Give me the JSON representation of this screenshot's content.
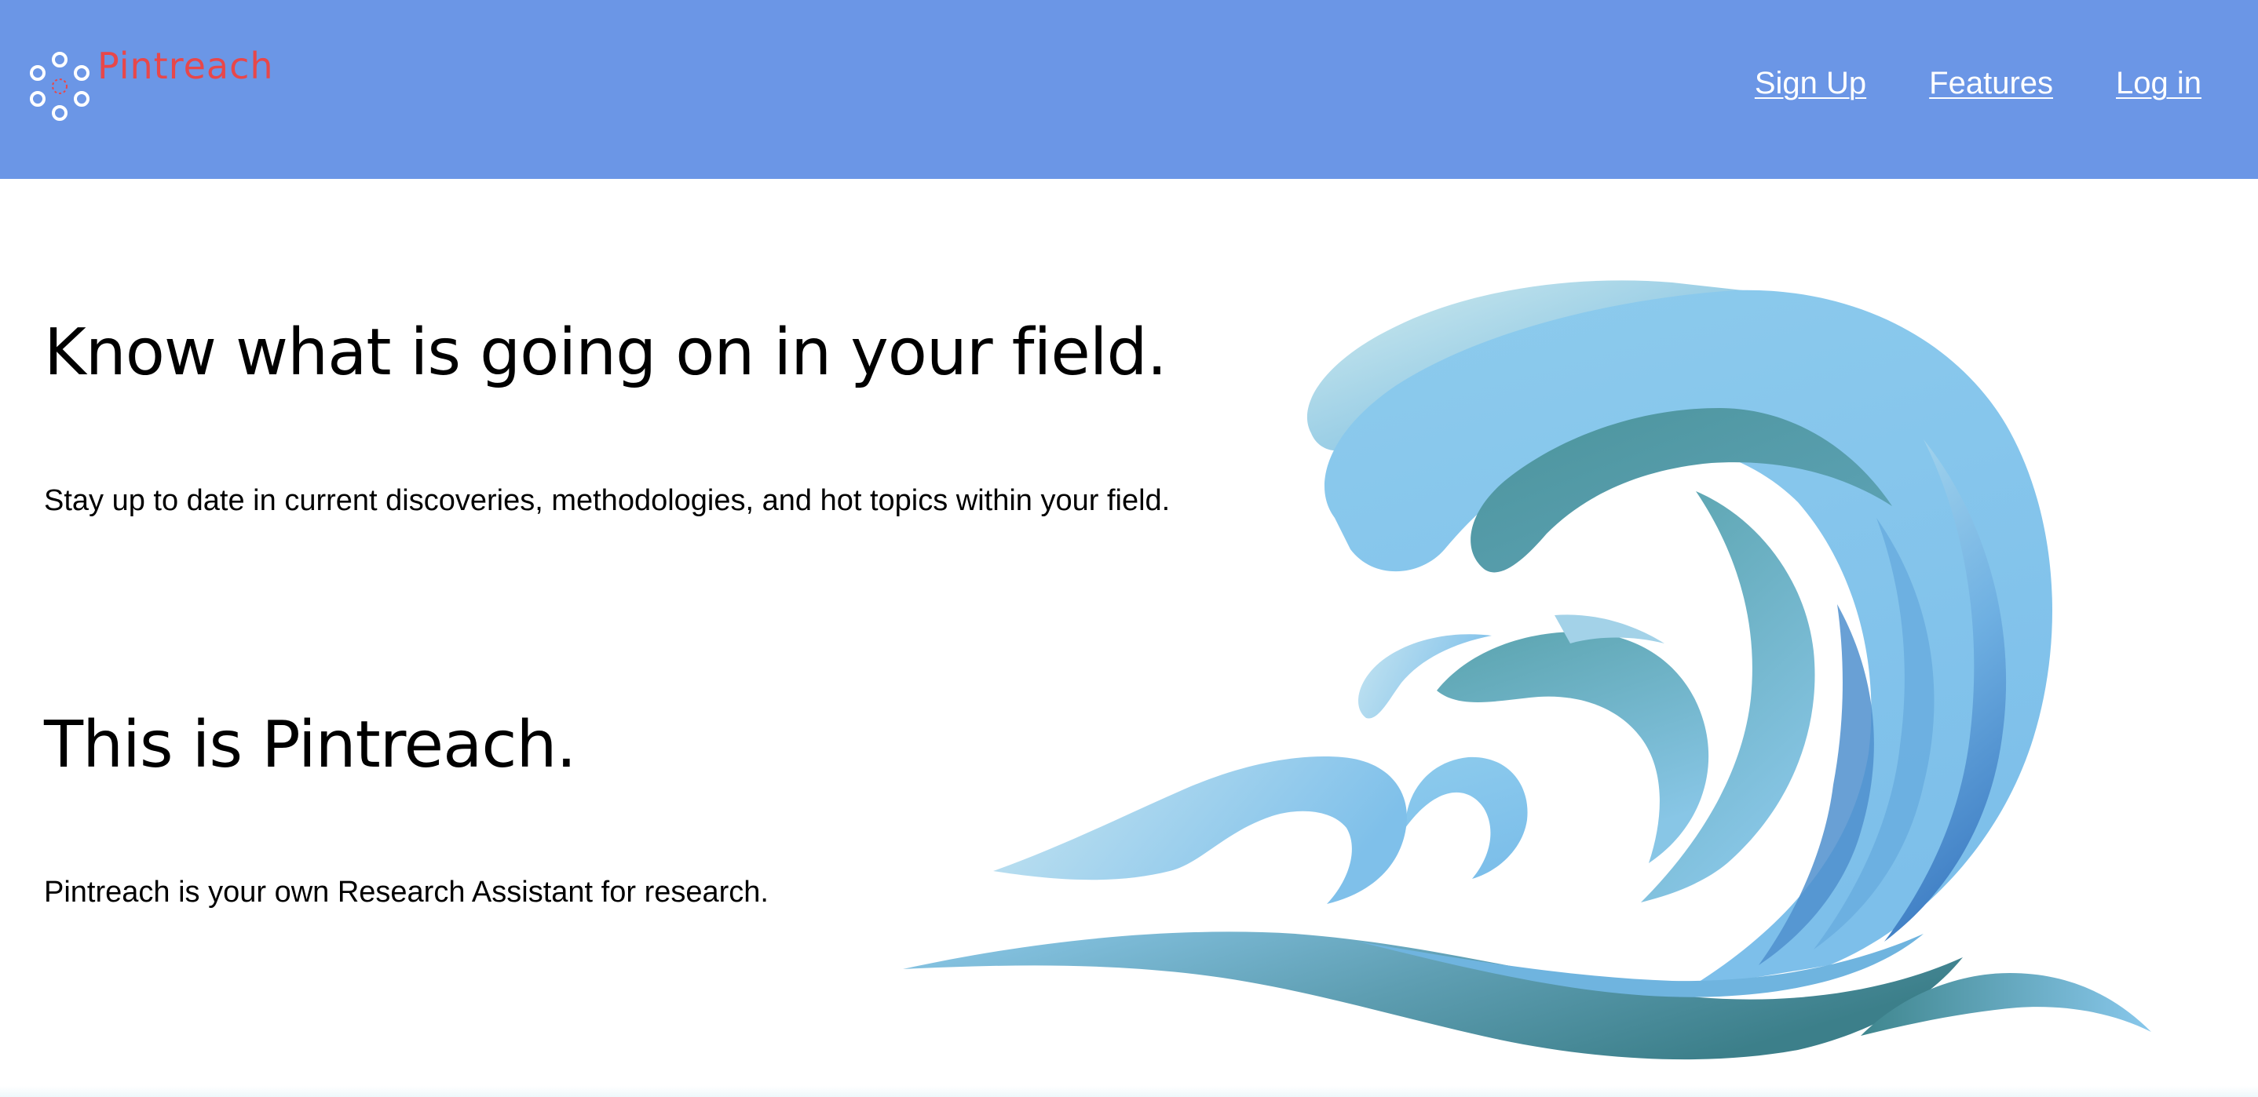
{
  "header": {
    "brand_name": "Pintreach",
    "background_color": "#6b96e6",
    "brand_color": "#e8474a",
    "logo_icon": "dots-ring-logo-icon",
    "nav": [
      {
        "label": "Sign Up"
      },
      {
        "label": "Features"
      },
      {
        "label": "Log in"
      }
    ]
  },
  "hero": {
    "sections": [
      {
        "heading": "Know what is going on in your field.",
        "text": "Stay up to date in current discoveries, methodologies, and hot topics within your field."
      },
      {
        "heading": "This is Pintreach.",
        "text": "Pintreach is your own Research Assistant for research."
      }
    ],
    "illustration": "ocean-wave-illustration"
  }
}
